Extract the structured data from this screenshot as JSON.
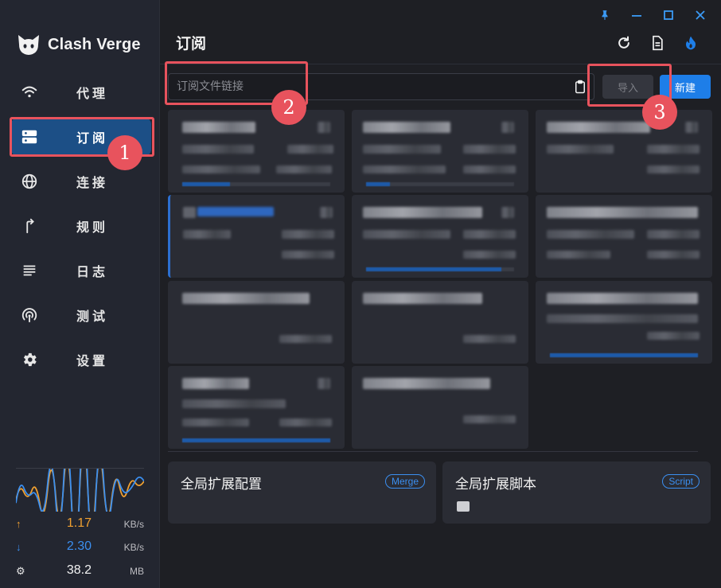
{
  "app": {
    "name": "Clash Verge"
  },
  "sidebar": {
    "items": [
      {
        "label": "代理",
        "icon": "wifi-icon"
      },
      {
        "label": "订阅",
        "icon": "server-icon",
        "active": true
      },
      {
        "label": "连接",
        "icon": "globe-icon"
      },
      {
        "label": "规则",
        "icon": "route-icon"
      },
      {
        "label": "日志",
        "icon": "list-icon"
      },
      {
        "label": "测试",
        "icon": "radar-icon"
      },
      {
        "label": "设置",
        "icon": "gear-icon"
      }
    ]
  },
  "traffic": {
    "upload": {
      "value": "1.17",
      "unit": "KB/s",
      "icon": "arrow-up-icon",
      "color": "#f0a030"
    },
    "download": {
      "value": "2.30",
      "unit": "KB/s",
      "icon": "arrow-down-icon",
      "color": "#3b8ff0"
    },
    "memory": {
      "value": "38.2",
      "unit": "MB",
      "icon": "memory-icon"
    }
  },
  "header": {
    "title": "订阅"
  },
  "toolbar": {
    "url_placeholder": "订阅文件链接",
    "import_label": "导入",
    "new_label": "新建"
  },
  "extensions": [
    {
      "title": "全局扩展配置",
      "chip": "Merge"
    },
    {
      "title": "全局扩展脚本",
      "chip": "Script"
    }
  ],
  "annotations": [
    "1",
    "2",
    "3"
  ],
  "colors": {
    "accent": "#1e7ee8",
    "active_nav": "#1c4f86",
    "annotation": "#e8535d"
  }
}
